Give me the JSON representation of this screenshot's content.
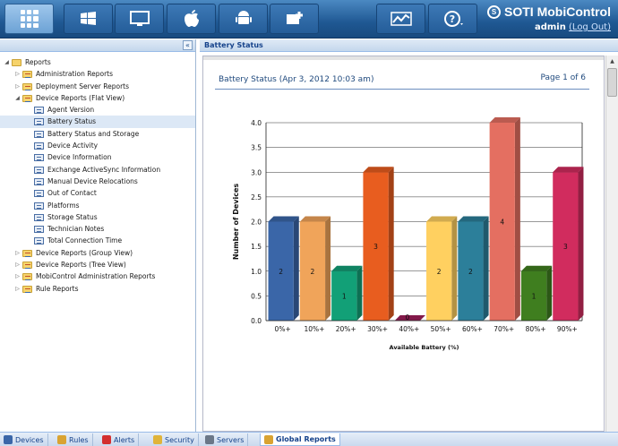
{
  "brand": {
    "name": "SOTI MobiControl",
    "user": "admin",
    "logout": "(Log Out)"
  },
  "top_nav": [
    {
      "name": "all-devices",
      "icon": "grid-icon",
      "active": true
    },
    {
      "name": "windows-devices",
      "icon": "windows-logo-icon"
    },
    {
      "name": "windows-desktop",
      "icon": "desktop-icon"
    },
    {
      "name": "apple-devices",
      "icon": "apple-icon"
    },
    {
      "name": "android-devices",
      "icon": "android-icon"
    },
    {
      "name": "other-devices",
      "icon": "device-plus-icon"
    },
    {
      "name": "charts",
      "icon": "line-chart-icon"
    },
    {
      "name": "help",
      "icon": "help-icon"
    }
  ],
  "left_panel": {
    "collapse_label": "«",
    "tree": [
      {
        "level": 0,
        "label": "Reports",
        "type": "folder",
        "expanded": true
      },
      {
        "level": 1,
        "label": "Administration Reports",
        "type": "report-folder",
        "expanded": false
      },
      {
        "level": 1,
        "label": "Deployment Server Reports",
        "type": "report-folder",
        "expanded": false
      },
      {
        "level": 1,
        "label": "Device Reports (Flat View)",
        "type": "report-folder",
        "expanded": true
      },
      {
        "level": 2,
        "label": "Agent Version",
        "type": "doc"
      },
      {
        "level": 2,
        "label": "Battery Status",
        "type": "doc",
        "selected": true
      },
      {
        "level": 2,
        "label": "Battery Status and Storage",
        "type": "doc"
      },
      {
        "level": 2,
        "label": "Device Activity",
        "type": "doc"
      },
      {
        "level": 2,
        "label": "Device Information",
        "type": "doc"
      },
      {
        "level": 2,
        "label": "Exchange ActiveSync Information",
        "type": "doc"
      },
      {
        "level": 2,
        "label": "Manual Device Relocations",
        "type": "doc"
      },
      {
        "level": 2,
        "label": "Out of Contact",
        "type": "doc"
      },
      {
        "level": 2,
        "label": "Platforms",
        "type": "doc"
      },
      {
        "level": 2,
        "label": "Storage Status",
        "type": "doc"
      },
      {
        "level": 2,
        "label": "Technician Notes",
        "type": "doc"
      },
      {
        "level": 2,
        "label": "Total Connection Time",
        "type": "doc"
      },
      {
        "level": 1,
        "label": "Device Reports (Group View)",
        "type": "report-folder",
        "expanded": false
      },
      {
        "level": 1,
        "label": "Device Reports (Tree View)",
        "type": "report-folder",
        "expanded": false
      },
      {
        "level": 1,
        "label": "MobiControl Administration Reports",
        "type": "report-folder",
        "expanded": false
      },
      {
        "level": 1,
        "label": "Rule Reports",
        "type": "report-folder",
        "expanded": false
      }
    ]
  },
  "right_panel": {
    "header": "Battery Status",
    "report_title": "Battery Status  (Apr 3, 2012 10:03 am)",
    "page_info": "Page 1 of 6"
  },
  "chart_data": {
    "type": "bar",
    "categories": [
      "0%+",
      "10%+",
      "20%+",
      "30%+",
      "40%+",
      "50%+",
      "60%+",
      "70%+",
      "80%+",
      "90%+"
    ],
    "values": [
      2,
      2,
      1,
      3,
      0,
      2,
      2,
      4,
      1,
      3
    ],
    "colors": [
      "#3a66a8",
      "#f0a45a",
      "#12a077",
      "#e85d1f",
      "#a01f5a",
      "#ffd060",
      "#2c7f9a",
      "#e46f61",
      "#3f7e1f",
      "#d12c5e"
    ],
    "ylabel": "Number of Devices",
    "xlabel": "Available Battery (%)",
    "ylim": [
      0,
      4
    ],
    "yticks": [
      "0.0",
      "0.5",
      "1.0",
      "1.5",
      "2.0",
      "2.5",
      "3.0",
      "3.5",
      "4.0"
    ],
    "grid": true,
    "bar_style": "3d"
  },
  "bottom_tabs": [
    {
      "label": "Devices",
      "icon": "device-icon",
      "color": "#3a66a8"
    },
    {
      "label": "Rules",
      "icon": "rules-icon",
      "color": "#d9a332"
    },
    {
      "label": "Alerts",
      "icon": "alert-icon",
      "color": "#d32f2f"
    },
    {
      "label": "Security",
      "icon": "shield-icon",
      "color": "#e0b43a"
    },
    {
      "label": "Servers",
      "icon": "server-icon",
      "color": "#6b7788"
    },
    {
      "label": "Global Reports",
      "icon": "reports-icon",
      "color": "#d9a332",
      "active": true
    }
  ]
}
